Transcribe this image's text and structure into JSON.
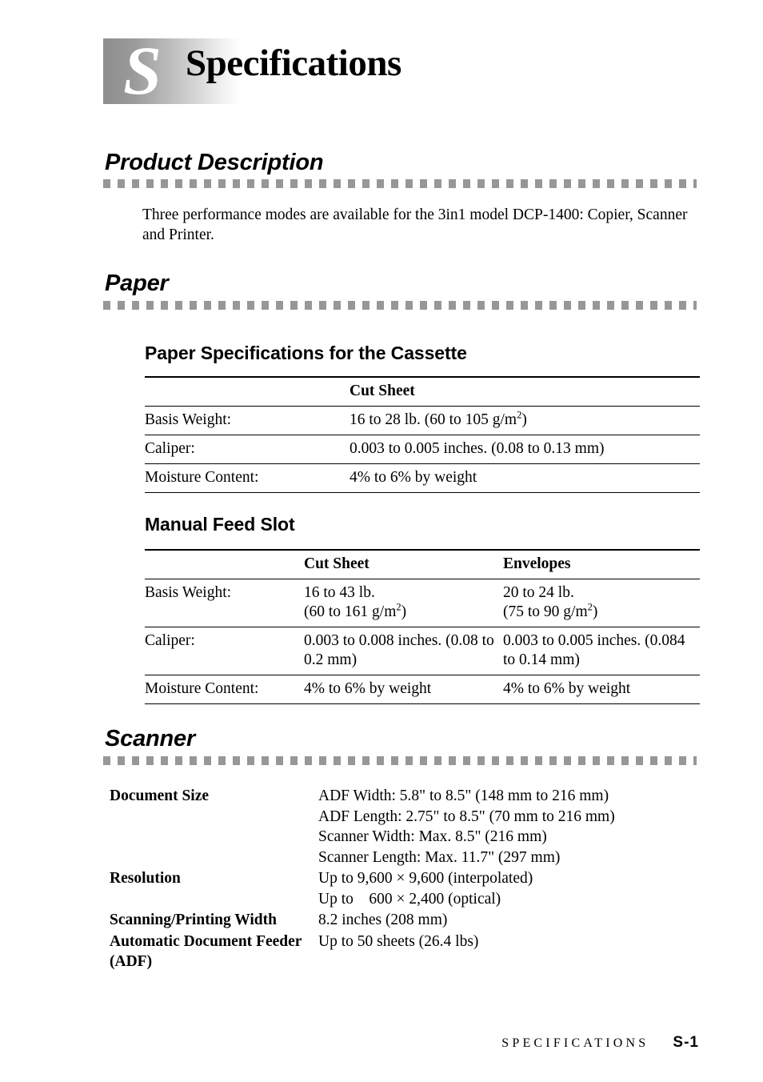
{
  "chapter": {
    "letter": "S",
    "title": "Specifications"
  },
  "sections": {
    "product_description": {
      "heading": "Product Description",
      "paragraph": "Three performance modes are available for the 3in1 model DCP-1400: Copier, Scanner and Printer."
    },
    "paper": {
      "heading": "Paper",
      "cassette": {
        "subheading": "Paper Specifications for the Cassette",
        "columns": [
          "",
          "Cut Sheet"
        ],
        "rows": [
          {
            "label": "Basis Weight:",
            "cut_sheet": "16 to 28 lb. (60 to 105 g/m2)"
          },
          {
            "label": "Caliper:",
            "cut_sheet": "0.003 to 0.005 inches. (0.08 to 0.13 mm)"
          },
          {
            "label": "Moisture Content:",
            "cut_sheet": "4% to 6% by weight"
          }
        ]
      },
      "manual_feed": {
        "subheading": "Manual Feed Slot",
        "columns": [
          "",
          "Cut Sheet",
          "Envelopes"
        ],
        "rows": [
          {
            "label": "Basis Weight:",
            "cut_sheet_line1": "16 to 43 lb.",
            "cut_sheet_line2": "(60 to 161 g/m2)",
            "envelopes_line1": "20 to 24 lb.",
            "envelopes_line2": "(75 to 90 g/m2)"
          },
          {
            "label": "Caliper:",
            "cut_sheet_line1": "0.003 to 0.008 inches.",
            "cut_sheet_line2": "(0.08 to 0.2 mm)",
            "envelopes_line1": "0.003 to 0.005 inches.",
            "envelopes_line2": "(0.084 to 0.14 mm)"
          },
          {
            "label": "Moisture Content:",
            "cut_sheet_line1": "4% to 6% by weight",
            "cut_sheet_line2": "",
            "envelopes_line1": "4% to 6% by weight",
            "envelopes_line2": ""
          }
        ]
      }
    },
    "scanner": {
      "heading": "Scanner",
      "rows": [
        {
          "term": "Document Size",
          "lines": [
            "ADF Width: 5.8\" to 8.5\" (148 mm to 216 mm)",
            "ADF Length: 2.75\" to 8.5\" (70 mm to 216 mm)",
            "Scanner Width: Max. 8.5\" (216 mm)",
            "Scanner Length: Max. 11.7\" (297 mm)"
          ]
        },
        {
          "term": "Resolution",
          "lines": [
            "Up to 9,600 × 9,600 (interpolated)",
            "Up to    600 × 2,400 (optical)"
          ]
        },
        {
          "term": "Scanning/Printing Width",
          "lines": [
            "8.2 inches (208 mm)"
          ]
        },
        {
          "term": "Automatic Document Feeder (ADF)",
          "term_line1": "Automatic Document",
          "term_line2": "Feeder (ADF)",
          "lines": [
            "Up to 50 sheets (26.4 lbs)"
          ]
        }
      ]
    }
  },
  "footer": {
    "label": "SPECIFICATIONS",
    "page": "S-1"
  },
  "colors": {
    "rule_gray": "#979797",
    "banner_dark": "#8e8e8e",
    "text": "#000000"
  }
}
